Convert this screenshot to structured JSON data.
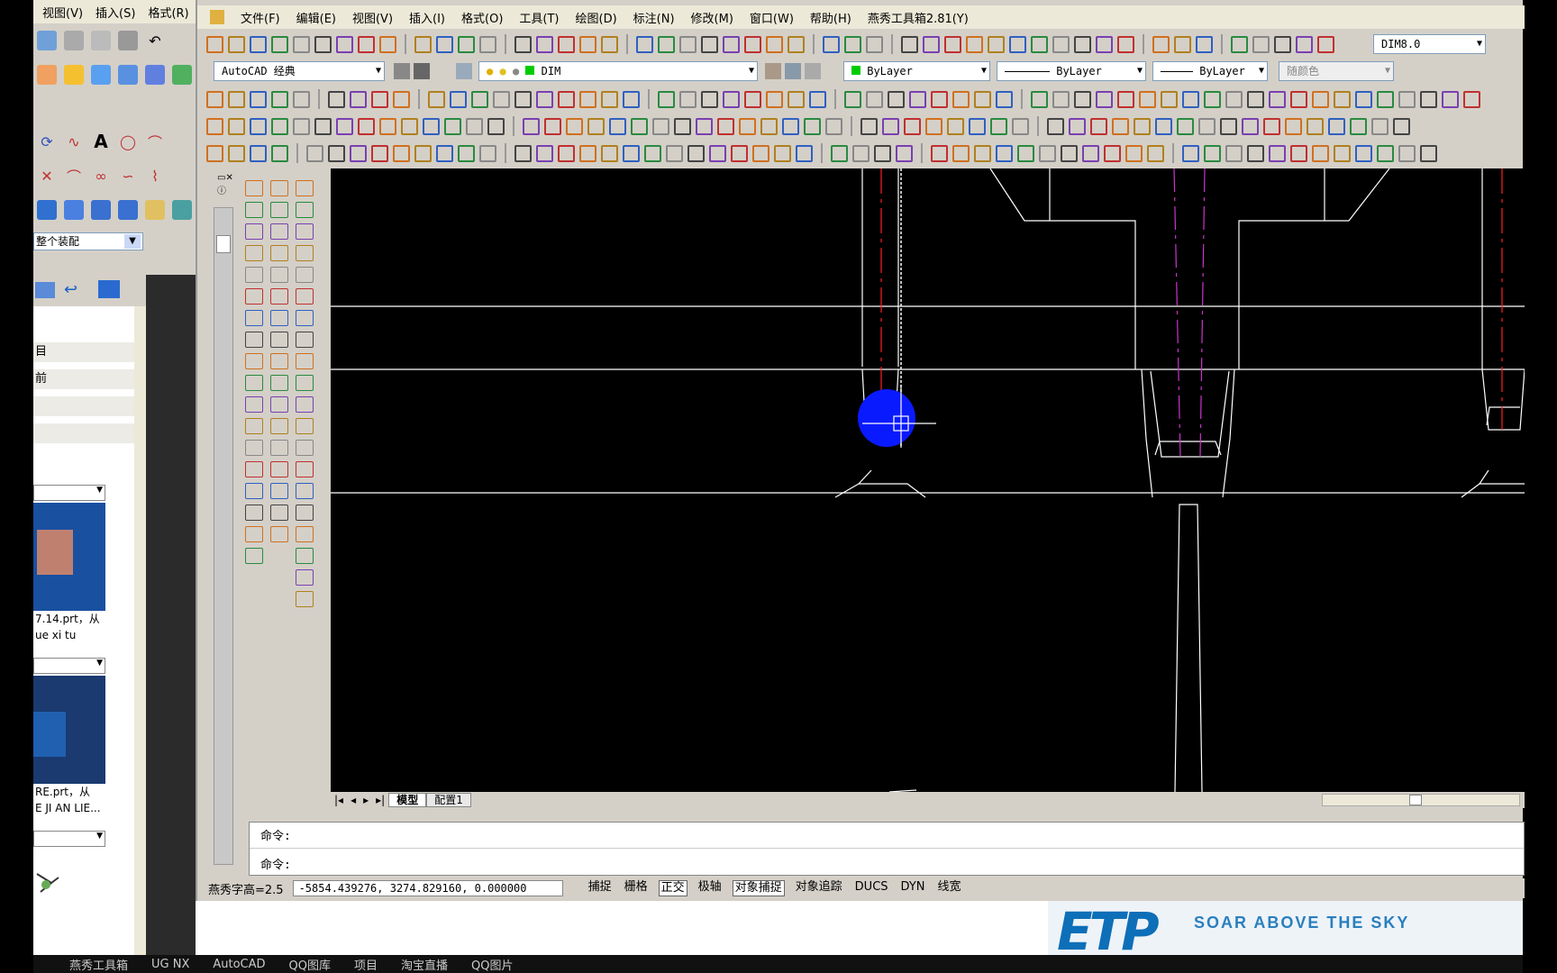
{
  "nx": {
    "menu": [
      "视图(V)",
      "插入(S)",
      "格式(R)"
    ],
    "assembly_combo": "整个装配",
    "panel_rows": [
      "目",
      "前"
    ],
    "part1_caption_line1": "7.14.prt，从",
    "part1_caption_line2": "ue xi tu",
    "part2_caption_line1": "RE.prt，从",
    "part2_caption_line2": "E JI AN LIE..."
  },
  "acad": {
    "menu": [
      "文件(F)",
      "编辑(E)",
      "视图(V)",
      "插入(I)",
      "格式(O)",
      "工具(T)",
      "绘图(D)",
      "标注(N)",
      "修改(M)",
      "窗口(W)",
      "帮助(H)",
      "燕秀工具箱2.81(Y)"
    ],
    "workspace_combo": "AutoCAD 经典",
    "dim_style_combo": "DIM8.0",
    "layer_combo": "DIM",
    "color_combo": "ByLayer",
    "linetype_combo": "ByLayer",
    "lineweight_combo": "ByLayer",
    "plotstyle_combo": "随颜色",
    "tabs": [
      "模型",
      "配置1"
    ],
    "command_lines": [
      "命令:",
      "命令:"
    ],
    "status": {
      "text_height": "燕秀字高=2.5",
      "coordinates": "-5854.439276, 3274.829160, 0.000000",
      "buttons": [
        "捕捉",
        "栅格",
        "正交",
        "极轴",
        "对象捕捉",
        "对象追踪",
        "DUCS",
        "DYN",
        "线宽"
      ],
      "active": [
        "正交",
        "对象捕捉"
      ]
    }
  },
  "banner": {
    "logo": "ETP",
    "slogan": "SOAR ABOVE THE SKY"
  },
  "taskbar": [
    "燕秀工具箱",
    "UG NX",
    "AutoCAD",
    "QQ图库",
    "项目",
    "淘宝直播",
    "QQ图片"
  ],
  "colors": {
    "canvas_bg": "#000000",
    "cursor_blob": "#0a1aff",
    "centerline_red": "#ff2020",
    "centerline_magenta": "#cc33cc",
    "geometry_white": "#ffffff",
    "window_chrome": "#d4d0c8"
  }
}
